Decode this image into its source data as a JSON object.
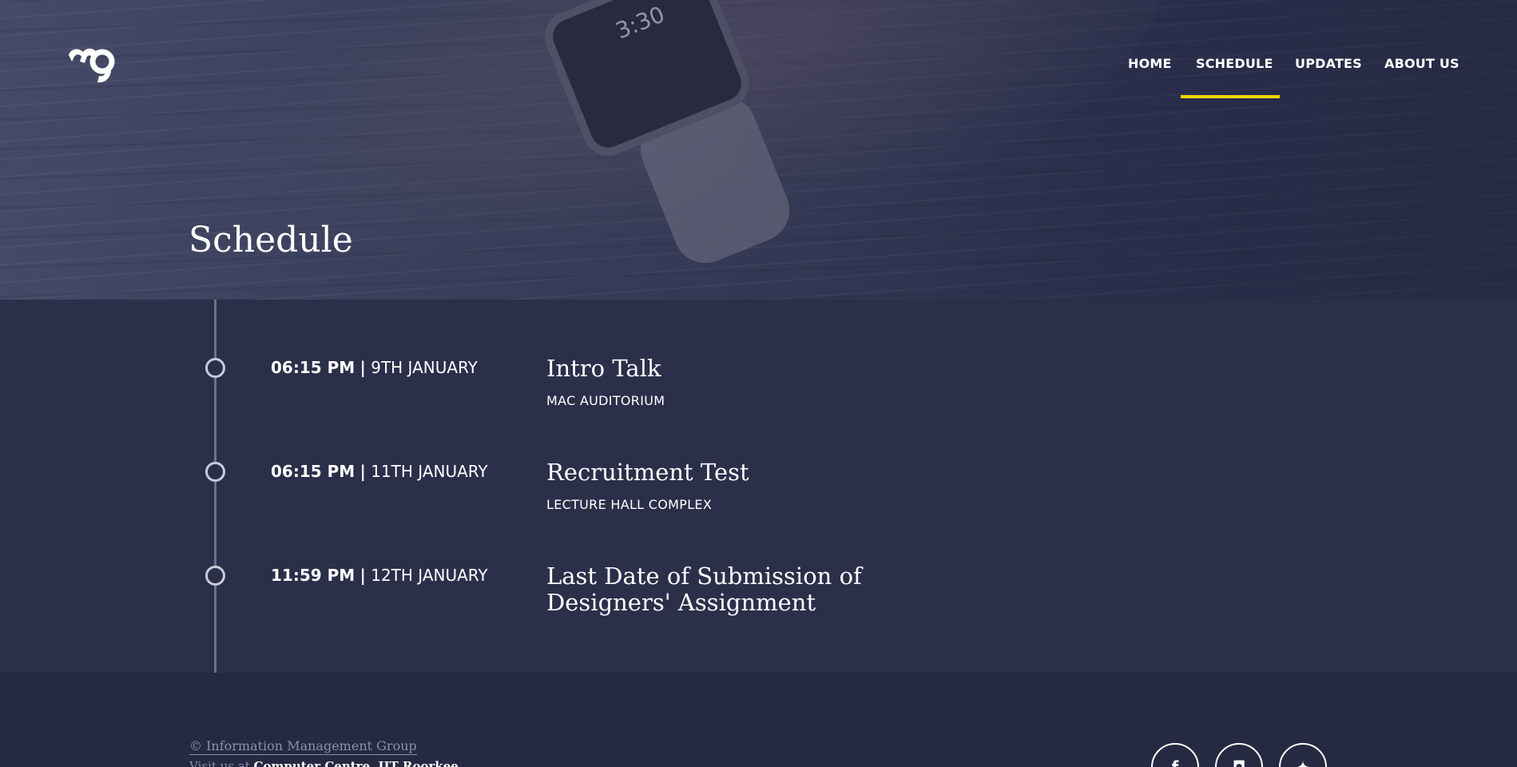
{
  "brand": {
    "logo_icon": "img-logo-icon"
  },
  "nav": {
    "items": [
      {
        "label": "HOME",
        "active": false
      },
      {
        "label": "SCHEDULE",
        "active": true
      },
      {
        "label": "UPDATES",
        "active": false
      },
      {
        "label": "ABOUT US",
        "active": false
      }
    ],
    "accent_color": "#f2d600"
  },
  "hero": {
    "title": "Schedule"
  },
  "schedule": {
    "events": [
      {
        "time": "06:15 PM",
        "separator": "|",
        "date": "9TH JANUARY",
        "title": "Intro Talk",
        "location": "MAC AUDITORIUM"
      },
      {
        "time": "06:15 PM",
        "separator": "|",
        "date": "11TH JANUARY",
        "title": "Recruitment Test",
        "location": "LECTURE HALL COMPLEX"
      },
      {
        "time": "11:59 PM",
        "separator": "|",
        "date": "12TH JANUARY",
        "title": "Last Date of Submission of Designers' Assignment",
        "location": ""
      }
    ]
  },
  "footer": {
    "copyright": "© Information Management Group",
    "credit_prefix": "Visit us at",
    "credit_bold": "Computer Centre, IIT Roorkee",
    "social": [
      {
        "icon": "facebook-icon",
        "glyph": "f"
      },
      {
        "icon": "github-icon",
        "glyph": "◘"
      },
      {
        "icon": "twitter-icon",
        "glyph": "✦"
      }
    ]
  }
}
